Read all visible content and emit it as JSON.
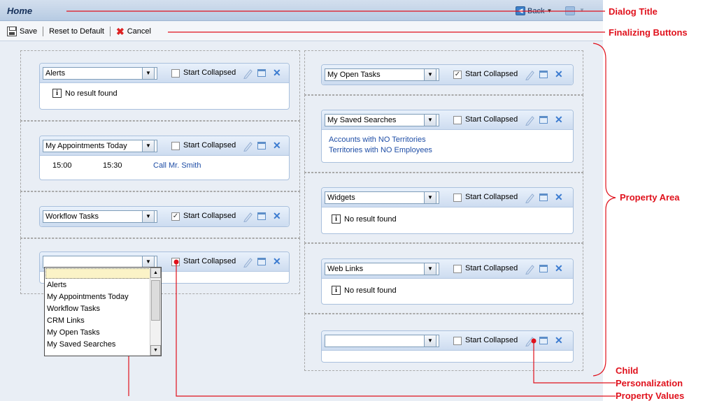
{
  "dialog": {
    "title": "Home",
    "back_label": "Back"
  },
  "toolbar": {
    "save_label": "Save",
    "reset_label": "Reset to Default",
    "cancel_label": "Cancel"
  },
  "widgets": {
    "left": [
      {
        "selected": "Alerts",
        "start_collapsed_label": "Start Collapsed",
        "checked": false,
        "body": {
          "type": "empty",
          "text": "No result found"
        }
      },
      {
        "selected": "My Appointments Today",
        "start_collapsed_label": "Start Collapsed",
        "checked": false,
        "body": {
          "type": "appointment",
          "start": "15:00",
          "end": "15:30",
          "subject": "Call Mr. Smith"
        }
      },
      {
        "selected": "Workflow Tasks",
        "start_collapsed_label": "Start Collapsed",
        "checked": true
      },
      {
        "selected": "",
        "start_collapsed_label": "Start Collapsed",
        "checked": false
      }
    ],
    "right": [
      {
        "selected": "My Open Tasks",
        "start_collapsed_label": "Start Collapsed",
        "checked": true
      },
      {
        "selected": "My Saved Searches",
        "start_collapsed_label": "Start Collapsed",
        "checked": false,
        "body": {
          "type": "links",
          "items": [
            "Accounts with NO Territories",
            "Territories with NO Employees"
          ]
        }
      },
      {
        "selected": "Widgets",
        "start_collapsed_label": "Start Collapsed",
        "checked": false,
        "body": {
          "type": "empty",
          "text": "No result found"
        }
      },
      {
        "selected": "Web Links",
        "start_collapsed_label": "Start Collapsed",
        "checked": false,
        "body": {
          "type": "empty",
          "text": "No result found"
        }
      },
      {
        "selected": "",
        "start_collapsed_label": "Start Collapsed",
        "checked": false
      }
    ]
  },
  "dropdown_options": [
    "",
    "Alerts",
    "My Appointments Today",
    "Workflow Tasks",
    "CRM Links",
    "My Open Tasks",
    "My Saved Searches"
  ],
  "annotations": {
    "dialog_title": "Dialog Title",
    "finalizing_buttons": "Finalizing Buttons",
    "property_area": "Property Area",
    "child_personalization_1": "Child",
    "child_personalization_2": "Personalization",
    "property_values": "Property Values"
  },
  "colors": {
    "annotation": "#e0111c",
    "link": "#1f4ea6",
    "header_top": "#d3dfee"
  }
}
